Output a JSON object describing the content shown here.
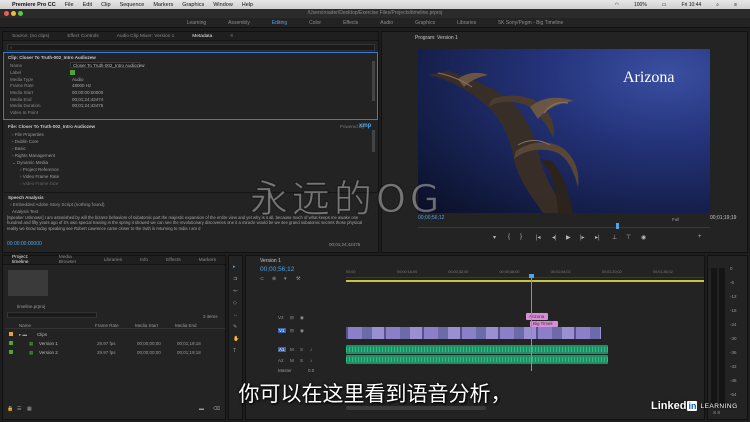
{
  "menubar": {
    "apple": "",
    "app": "Premiere Pro CC",
    "items": [
      "File",
      "Edit",
      "Clip",
      "Sequence",
      "Markers",
      "Graphics",
      "Window",
      "Help"
    ],
    "right": [
      "100%",
      "Fri 10:44"
    ]
  },
  "titlebar": {
    "path": "/Users/roader/Desktop/Exercise Files/Projects/timeline.prproj"
  },
  "workspaces": {
    "items": [
      "Learning",
      "Assembly",
      "Editing",
      "Color",
      "Effects",
      "Audio",
      "Graphics",
      "Libraries",
      "5K Sony/Pegm - Big Timeline"
    ],
    "active": "Editing"
  },
  "metadata_panel": {
    "tabs": [
      "Source: (no clips)",
      "Effect Controls",
      "Audio Clip Mixer: Version 1",
      "Metadata"
    ],
    "active_tab": "Metadata",
    "clip_header": "Clip: Closer To Truth-002_Intro Audiozew",
    "rows": [
      {
        "label": "Name",
        "value": "Closer To Truth-002_Intro Audiozew"
      },
      {
        "label": "Label",
        "value": ""
      },
      {
        "label": "Media Type",
        "value": "Audio"
      },
      {
        "label": "Frame Rate",
        "value": "48000 Hz"
      },
      {
        "label": "Media Start",
        "value": "00:00:00:00000"
      },
      {
        "label": "Media End",
        "value": "00;01;24;42474"
      },
      {
        "label": "Media Duration",
        "value": "00;01;24;42475"
      },
      {
        "label": "Video In Point",
        "value": ""
      }
    ],
    "file_header": "File: Closer To Truth-002_Intro Audiozew",
    "powered_by": "Powered By",
    "xmp": "xmp",
    "sections": [
      "File Properties",
      "Dublin Core",
      "Basic",
      "Rights Management",
      "Dynamic Media",
      "Project Reference",
      "Video Frame Rate",
      "Video Frame Size"
    ],
    "speech_header": "Speech Analysis",
    "speech_script": "Embedded Adobe Story Script (nothing found)",
    "analysis_text": "Analysis Text",
    "transcript": "[Speaker Unknown] I am astonished by will the bizarre behaviors of subatomic part the majestic expansion of the entire view and yet why is it all, because much of what keeps me awake one hundred and fifty years ago of it's own special training in the spring it showed we can see the revolutionary discoveries one it a miracle would be we see grand subatomic secrets those physical reality we know today speaking see Robert Lawrence came closer to the truth is returning to India I am d",
    "timecode_left": "00:00:00:00000",
    "timecode_right": "00;01;24;42475"
  },
  "program_monitor": {
    "label": "Program: Version 1",
    "title_overlay": "Arizona",
    "timecode": "00;00;56;12",
    "fit": "Full",
    "duration": "00;01;19;19",
    "controls": [
      "marker-icon",
      "in-icon",
      "out-icon",
      "go-in-icon",
      "step-back-icon",
      "play-icon",
      "step-fwd-icon",
      "go-out-icon",
      "lift-icon",
      "extract-icon",
      "export-frame-icon"
    ]
  },
  "project_panel": {
    "tabs": [
      "Project: timeline",
      "Media Browser",
      "Libraries",
      "Info",
      "Effects",
      "Markers"
    ],
    "active_tab": "Project: timeline",
    "filename": "timeline.prproj",
    "count": "3 items",
    "columns": [
      "Name",
      "Frame Rate",
      "Media Start",
      "Media End"
    ],
    "rows": [
      {
        "name": "Clips",
        "rate": "",
        "start": "",
        "end": "",
        "color": "#e7a13a",
        "folder": true
      },
      {
        "name": "Version 1",
        "rate": "29.97 fps",
        "start": "00;00;00;00",
        "end": "00;01;19;18",
        "color": "#4fa33b",
        "folder": false
      },
      {
        "name": "Version 2",
        "rate": "29.97 fps",
        "start": "00;00;00;00",
        "end": "00;01;19;18",
        "color": "#4fa33b",
        "folder": false
      }
    ]
  },
  "timeline": {
    "tab": "Version 1",
    "timecode": "00;00;56;12",
    "ruler": [
      "00;00",
      "00;00;16;00",
      "00;00;32;00",
      "00;00;48;00",
      "00;01;04;02",
      "00;01;20;02",
      "00;01;36;02"
    ],
    "tracks": [
      "V2",
      "V1",
      "A1",
      "A2"
    ],
    "master_label": "Master",
    "master_value": "0.0",
    "title_clips": [
      "Arizona",
      "Big Timeli"
    ]
  },
  "meter": {
    "labels": [
      "0",
      "-6",
      "-12",
      "-18",
      "-24",
      "-30",
      "-36",
      "-42",
      "-48",
      "-54"
    ],
    "bottom": "S S"
  },
  "overlay": {
    "watermark": "永远的OG",
    "subtitle": "你可以在这里看到语音分析，",
    "brand": "Linked",
    "brand_in": "in",
    "brand_suffix": "LEARNING"
  },
  "colors": {
    "accent": "#4fa3e8",
    "video_clip": "#8b7fc7",
    "audio_clip": "#1f8f66",
    "title_clip": "#d98fd8",
    "playhead": "#4fa3e8"
  }
}
